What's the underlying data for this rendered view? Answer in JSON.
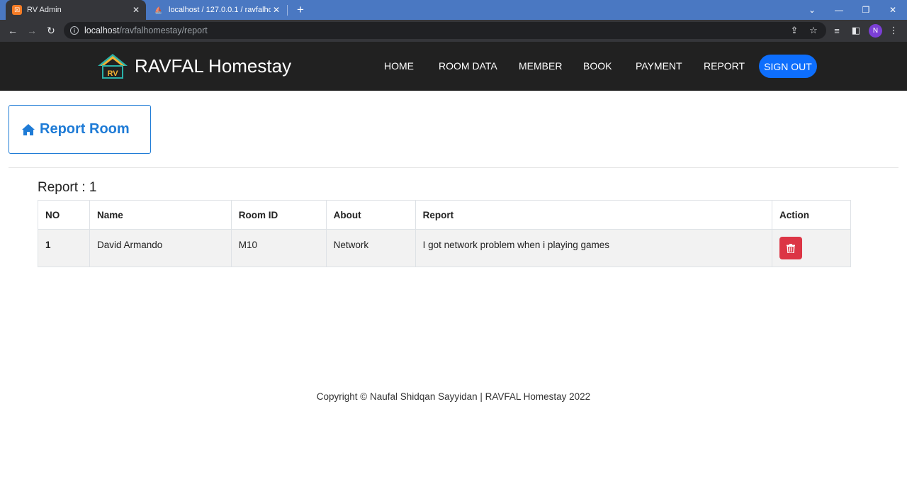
{
  "browser": {
    "tabs": [
      {
        "title": "RV Admin",
        "active": true
      },
      {
        "title": "localhost / 127.0.0.1 / ravfalhome",
        "active": false
      }
    ],
    "url_host": "localhost",
    "url_path": "/ravfalhomestay/report",
    "profile_initial": "N"
  },
  "site": {
    "brand_name": "RAVFAL Homestay",
    "nav": {
      "home": "HOME",
      "room_data": "ROOM DATA",
      "member": "MEMBER",
      "book": "BOOK",
      "payment": "PAYMENT",
      "report": "REPORT",
      "sign_out": "SIGN OUT"
    }
  },
  "page": {
    "title": "Report Room",
    "report_count_label": "Report : 1",
    "table": {
      "headers": {
        "no": "NO",
        "name": "Name",
        "room_id": "Room ID",
        "about": "About",
        "report": "Report",
        "action": "Action"
      },
      "rows": [
        {
          "no": "1",
          "name": "David Armando",
          "room_id": "M10",
          "about": "Network",
          "report": "I got network problem when i playing games"
        }
      ]
    }
  },
  "footer": {
    "text": "Copyright © Naufal Shidqan Sayyidan | RAVFAL Homestay 2022"
  },
  "colors": {
    "accent": "#1e7bd6",
    "navbar": "#212121",
    "signout": "#0d6efd",
    "danger": "#dc3545"
  },
  "icons": [
    "home-icon",
    "trash-icon",
    "logo-icon"
  ]
}
